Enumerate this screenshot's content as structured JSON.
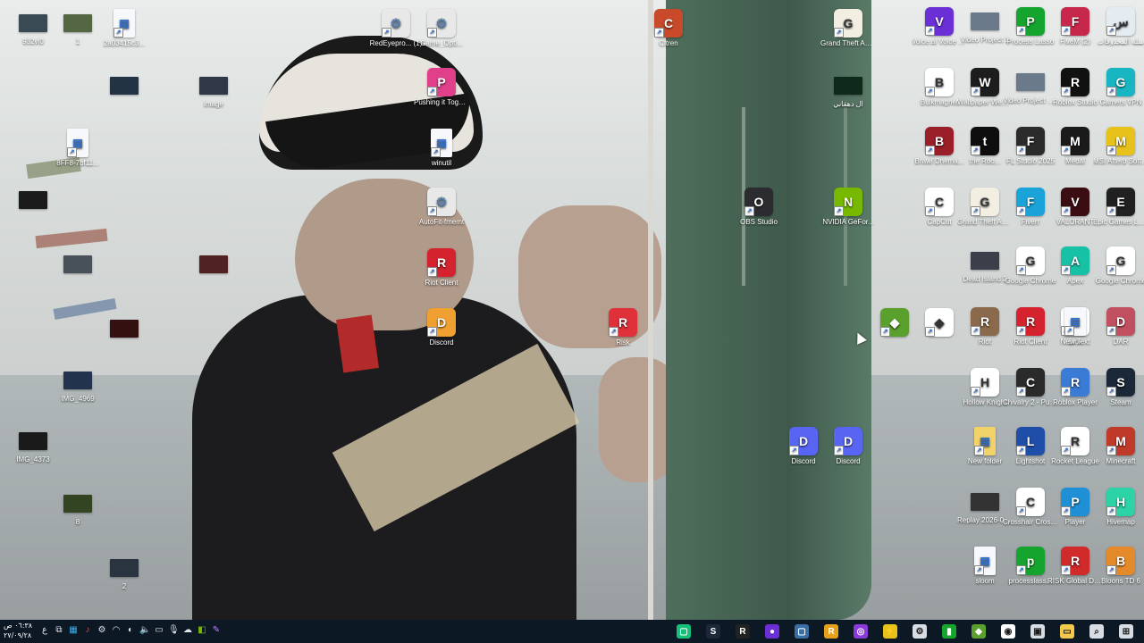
{
  "desktop": {
    "icons": [
      {
        "label": "932vl0",
        "kind": "thumb",
        "color": "#3a4a55"
      },
      {
        "label": "1",
        "kind": "thumb",
        "color": "#556644"
      },
      {
        "label": "2a03415c3...",
        "kind": "file",
        "color": "#f6f8fb"
      },
      {
        "label": "",
        "kind": "thumb",
        "color": "#223344"
      },
      {
        "label": "image",
        "kind": "thumb",
        "color": "#303848"
      },
      {
        "label": "8FF8-7bf11...",
        "kind": "file",
        "color": "#f6f8fb"
      },
      {
        "label": "",
        "kind": "thumb",
        "color": "#1b1b1b"
      },
      {
        "label": "",
        "kind": "thumb",
        "color": "#48505a"
      },
      {
        "label": "",
        "kind": "thumb",
        "color": "#512222"
      },
      {
        "label": "",
        "kind": "thumb",
        "color": "#331111"
      },
      {
        "label": "IMG_4969",
        "kind": "thumb",
        "color": "#22334d"
      },
      {
        "label": "IMG_4373",
        "kind": "thumb",
        "color": "#1a1a1a"
      },
      {
        "label": "8",
        "kind": "thumb",
        "color": "#334422"
      },
      {
        "label": "2",
        "kind": "thumb",
        "color": "#2a3340"
      },
      {
        "label": "RedEyepro... (1)",
        "kind": "gear",
        "color": "#e8e8e8"
      },
      {
        "label": "Game_Opti...",
        "kind": "gear",
        "color": "#e8e8e8"
      },
      {
        "label": "Pushing it Together...",
        "kind": "app",
        "color": "#e0408a"
      },
      {
        "label": "winutil",
        "kind": "file",
        "color": "#f6f8fb"
      },
      {
        "label": "AutoFit-fmemt",
        "kind": "gear",
        "color": "#e8e8e8"
      },
      {
        "label": "Riot Client",
        "kind": "app",
        "color": "#d4232f"
      },
      {
        "label": "Discord",
        "kind": "app",
        "color": "#f0a030"
      },
      {
        "label": "Risk",
        "kind": "app",
        "color": "#e0303a"
      },
      {
        "label": "Citren",
        "kind": "app",
        "color": "#c84a2a"
      },
      {
        "label": "Grand Theft Auto V Le...",
        "kind": "app",
        "color": "#f2efe2"
      },
      {
        "label": "ال دهقاني",
        "kind": "thumb",
        "color": "#0f2a1a"
      },
      {
        "label": "OBS Studio",
        "kind": "app",
        "color": "#2c2c30"
      },
      {
        "label": "NVIDIA GeFor...",
        "kind": "app",
        "color": "#76b900"
      },
      {
        "label": "Discord",
        "kind": "app",
        "color": "#5865f2"
      },
      {
        "label": "Discord",
        "kind": "app",
        "color": "#5865f2"
      },
      {
        "label": "",
        "kind": "app",
        "color": "#5aa02c"
      },
      {
        "label": "",
        "kind": "app",
        "color": "#ffffff"
      },
      {
        "label": "Voice.ai Voice C...",
        "kind": "app",
        "color": "#6b2fd6"
      },
      {
        "label": "Video Project 1",
        "kind": "thumb",
        "color": "#6a7a8a"
      },
      {
        "label": "Process Lasso",
        "kind": "app",
        "color": "#15a42d"
      },
      {
        "label": "FiveM (2)",
        "kind": "app",
        "color": "#c8274c"
      },
      {
        "label": "سلة المحذوفات",
        "kind": "app",
        "color": "#e4ecf2"
      },
      {
        "label": "Bulkmagnet",
        "kind": "app",
        "color": "#ffffff"
      },
      {
        "label": "Wallpaper Webconf",
        "kind": "app",
        "color": "#1d1d1d"
      },
      {
        "label": "Video Project 6 - ال...",
        "kind": "thumb",
        "color": "#6a7a8a"
      },
      {
        "label": "Roblox Studio",
        "kind": "app",
        "color": "#111111"
      },
      {
        "label": "Gamers VPN",
        "kind": "app",
        "color": "#17b6c2"
      },
      {
        "label": "Brawl Dhema...",
        "kind": "app",
        "color": "#9a1f28"
      },
      {
        "label": "the Roo...",
        "kind": "app",
        "color": "#0e0e0e"
      },
      {
        "label": "FL Studio 2025",
        "kind": "app",
        "color": "#2b2b2b"
      },
      {
        "label": "Medal",
        "kind": "app",
        "color": "#1a1a1a"
      },
      {
        "label": "MSI Afterb Software",
        "kind": "app",
        "color": "#e6c21a"
      },
      {
        "label": "CapCut",
        "kind": "app",
        "color": "#ffffff"
      },
      {
        "label": "Grand Theft Auto V Enh...",
        "kind": "app",
        "color": "#f2efe2"
      },
      {
        "label": "Fiverr",
        "kind": "app",
        "color": "#1aa3d9"
      },
      {
        "label": "VALORANT",
        "kind": "app",
        "color": "#3a0d12"
      },
      {
        "label": "Epic Games Launcher",
        "kind": "app",
        "color": "#202020"
      },
      {
        "label": "Dead Island 2",
        "kind": "thumb",
        "color": "#3a3f4a"
      },
      {
        "label": "Google Chrome",
        "kind": "app",
        "color": "#ffffff"
      },
      {
        "label": "Apex",
        "kind": "app",
        "color": "#16c1a6"
      },
      {
        "label": "Google Chrome",
        "kind": "app",
        "color": "#ffffff"
      },
      {
        "label": "Blox",
        "kind": "app",
        "color": "#ffffff"
      },
      {
        "label": "Riot",
        "kind": "app",
        "color": "#8a6a4a"
      },
      {
        "label": "Riot Client",
        "kind": "app",
        "color": "#d4232f"
      },
      {
        "label": "New Text",
        "kind": "file",
        "color": "#f6f8fb"
      },
      {
        "label": "DAR",
        "kind": "app",
        "color": "#c05060"
      },
      {
        "label": "Hollow Knight",
        "kind": "app",
        "color": "#ffffff"
      },
      {
        "label": "Chivalry 2 - Public Te...",
        "kind": "app",
        "color": "#2a2a2a"
      },
      {
        "label": "Roblox Player",
        "kind": "app",
        "color": "#3a7bd5"
      },
      {
        "label": "Steam",
        "kind": "app",
        "color": "#1b2838"
      },
      {
        "label": "New folder",
        "kind": "file",
        "color": "#f2d36a"
      },
      {
        "label": "Lightshot",
        "kind": "app",
        "color": "#1f4ea8"
      },
      {
        "label": "Rocket League",
        "kind": "app",
        "color": "#ffffff"
      },
      {
        "label": "Minecraft",
        "kind": "app",
        "color": "#c03a2a"
      },
      {
        "label": "Replay 2026-02-...",
        "kind": "thumb",
        "color": "#333333"
      },
      {
        "label": "Crosshair Crossha...",
        "kind": "app",
        "color": "#ffffff"
      },
      {
        "label": "Player",
        "kind": "app",
        "color": "#1f8fd6"
      },
      {
        "label": "Hivemap",
        "kind": "app",
        "color": "#2bd3a7"
      },
      {
        "label": "sloom",
        "kind": "file",
        "color": "#f6f8fb"
      },
      {
        "label": "processlass...",
        "kind": "app",
        "color": "#15a42d"
      },
      {
        "label": "RISK Global Domination",
        "kind": "app",
        "color": "#d12a2a"
      },
      {
        "label": "Bloons TD 6",
        "kind": "app",
        "color": "#e58a2a"
      }
    ]
  },
  "taskbar": {
    "time": "٠٦:٣٨ ص",
    "date": "٢٧/٠٩/٢٨",
    "lang": "ع",
    "apps": [
      {
        "name": "mobile",
        "color": "#17c07a",
        "glyph": "▢"
      },
      {
        "name": "steam",
        "color": "#1b2838",
        "glyph": "S"
      },
      {
        "name": "roblox",
        "color": "#222222",
        "glyph": "R"
      },
      {
        "name": "cap",
        "color": "#6b2fd6",
        "glyph": "●"
      },
      {
        "name": "window",
        "color": "#3a6ea5",
        "glyph": "▢"
      },
      {
        "name": "r-app",
        "color": "#e6a11a",
        "glyph": "R"
      },
      {
        "name": "clip",
        "color": "#8a3ad9",
        "glyph": "◎"
      },
      {
        "name": "afterburner",
        "color": "#e6c21a",
        "glyph": "⚡"
      },
      {
        "name": "settings",
        "color": "#d8dde3",
        "glyph": "⚙"
      },
      {
        "name": "process-lasso",
        "color": "#15a42d",
        "glyph": "▮"
      },
      {
        "name": "minecraft",
        "color": "#5aa02c",
        "glyph": "◆"
      },
      {
        "name": "chrome",
        "color": "#ffffff",
        "glyph": "◉"
      },
      {
        "name": "store",
        "color": "#d8dde3",
        "glyph": "▣"
      },
      {
        "name": "file-explorer",
        "color": "#f2c94c",
        "glyph": "▭"
      },
      {
        "name": "search",
        "color": "#d8dde3",
        "glyph": "⌕"
      },
      {
        "name": "start",
        "color": "#d8dde3",
        "glyph": "⊞"
      }
    ]
  }
}
